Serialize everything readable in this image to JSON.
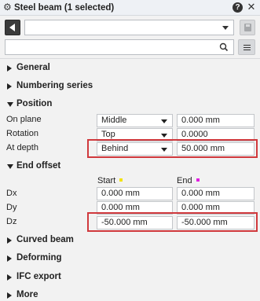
{
  "window": {
    "title": "Steel beam (1 selected)",
    "icons": {
      "settings": "gear-icon",
      "help": "help-icon",
      "close": "close-icon"
    }
  },
  "toolbar": {
    "back_icon": "back-arrow-icon",
    "preset_value": "",
    "save_icon": "save-icon",
    "search_placeholder": "",
    "search_icon": "search-icon",
    "menu_icon": "menu-icon"
  },
  "sections": {
    "general": "General",
    "numbering": "Numbering series",
    "position": "Position",
    "end_offset": "End offset",
    "curved_beam": "Curved beam",
    "deforming": "Deforming",
    "ifc_export": "IFC export",
    "more": "More"
  },
  "position": {
    "on_plane": {
      "label": "On plane",
      "select": "Middle",
      "value": "0.000 mm"
    },
    "rotation": {
      "label": "Rotation",
      "select": "Top",
      "value": "0.0000"
    },
    "at_depth": {
      "label": "At depth",
      "select": "Behind",
      "value": "50.000 mm"
    }
  },
  "end_offset": {
    "start_header": "Start",
    "end_header": "End",
    "start_color": "#f2e200",
    "end_color": "#e020e0",
    "dx": {
      "label": "Dx",
      "start": "0.000 mm",
      "end": "0.000 mm"
    },
    "dy": {
      "label": "Dy",
      "start": "0.000 mm",
      "end": "0.000 mm"
    },
    "dz": {
      "label": "Dz",
      "start": "-50.000 mm",
      "end": "-50.000 mm"
    }
  },
  "highlight_color": "#d0393d"
}
